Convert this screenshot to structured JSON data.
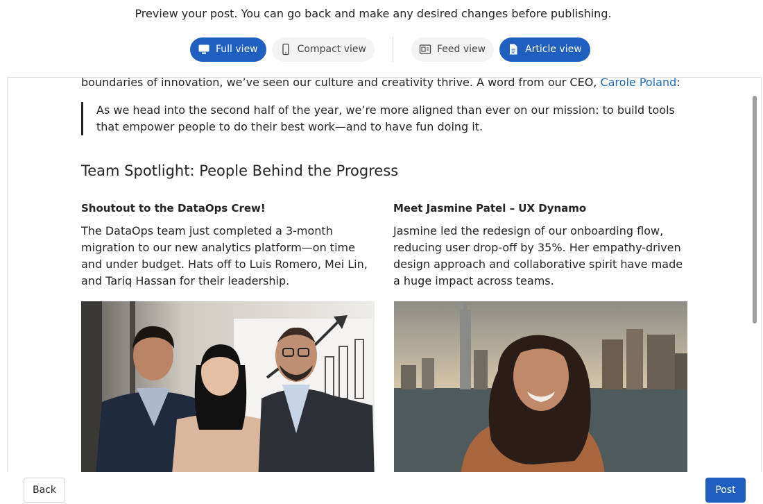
{
  "instructions": "Preview your post. You can go back and make any desired changes before publishing.",
  "view_toggle": {
    "layout": [
      {
        "label": "Full view",
        "icon": "monitor-icon",
        "active": true
      },
      {
        "label": "Compact view",
        "icon": "phone-icon",
        "active": false
      }
    ],
    "mode": [
      {
        "label": "Feed view",
        "icon": "feed-icon",
        "active": false
      },
      {
        "label": "Article view",
        "icon": "document-icon",
        "active": true
      }
    ]
  },
  "article": {
    "lead_text": "boundaries of innovation, we’ve seen our culture and creativity thrive. A word from our CEO, ",
    "ceo_link": "Carole Poland",
    "lead_end": ":",
    "quote": "As we head into the second half of the year, we’re more aligned than ever on our mission: to build tools that empower people to do their best work—and to have fun doing it.",
    "section_heading": "Team Spotlight: People Behind the Progress",
    "columns": [
      {
        "title": "Shoutout to the DataOps Crew!",
        "body": "The DataOps team just completed a 3-month migration to our new analytics platform—on time and under budget. Hats off to Luis Romero, Mei Lin, and Tariq Hassan for their leadership."
      },
      {
        "title": "Meet Jasmine Patel – UX Dynamo",
        "body": "Jasmine led the redesign of our onboarding flow, reducing user drop-off by 35%. Her empathy-driven design approach and collaborative spirit have made a huge impact across teams."
      }
    ]
  },
  "footer": {
    "back_label": "Back",
    "post_label": "Post"
  },
  "colors": {
    "accent": "#1f5fbf",
    "link": "#1c6bb8"
  }
}
